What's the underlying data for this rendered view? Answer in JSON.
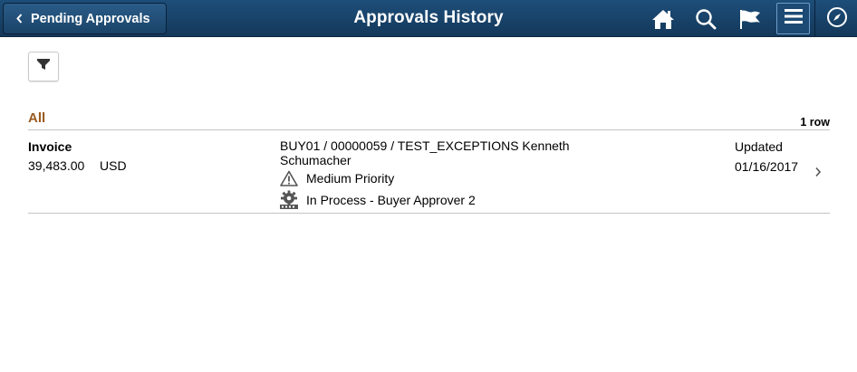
{
  "header": {
    "back_label": "Pending Approvals",
    "title": "Approvals History",
    "icons": [
      "home-icon",
      "search-icon",
      "flag-icon",
      "menu-icon",
      "navbar-compass-icon"
    ]
  },
  "filter": {
    "icon": "filter-icon"
  },
  "group": {
    "label": "All",
    "row_count": "1 row"
  },
  "rows": [
    {
      "doc_type": "Invoice",
      "amount": "39,483.00",
      "currency": "USD",
      "description": "BUY01 / 00000059 / TEST_EXCEPTIONS Kenneth Schumacher",
      "priority": "Medium Priority",
      "status": "In Process - Buyer Approver 2",
      "updated_label": "Updated",
      "updated_date": "01/16/2017"
    }
  ],
  "colors": {
    "header_bg": "#1a4468",
    "group_label": "#9a5a1e"
  }
}
